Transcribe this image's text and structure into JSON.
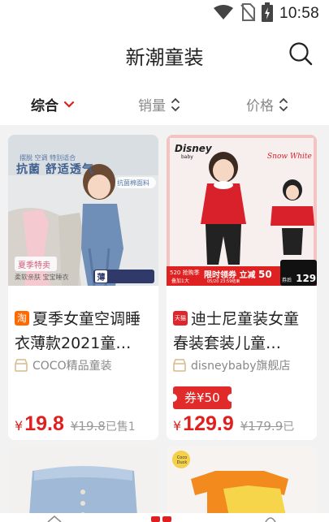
{
  "status_bar": {
    "time": "10:58",
    "icons": [
      "wifi-icon",
      "no-sim-icon",
      "battery-charging-icon"
    ]
  },
  "header": {
    "title": "新潮童装",
    "search_icon": "search-icon"
  },
  "sort_bar": {
    "items": [
      {
        "label": "综合",
        "state": "active"
      },
      {
        "label": "销量",
        "state": "sortable"
      },
      {
        "label": "价格",
        "state": "sortable"
      }
    ],
    "accent_color": "#e02020"
  },
  "products": [
    {
      "image_text": {
        "top_line": "摆脱 空调 特别适合",
        "headline": "抗菌 舒适透气",
        "badge": "抗菌棉面料",
        "bottom_left": "夏季特卖",
        "bottom_caption": "柔软亲肤 宝宝睡衣",
        "logo": "薄"
      },
      "platform_badge": "淘",
      "title": "夏季女童空调睡衣薄款2021童…",
      "shop": "COCO精品童装",
      "coupon": "",
      "currency": "¥",
      "price": "19.8",
      "original_price": "¥19.8",
      "sold": "已售1"
    },
    {
      "image_text": {
        "brand": "Disney",
        "brand_sub": "baby",
        "series": "Snow White",
        "promo_left": "520 抢购季",
        "promo_left_sub": "叠加1大",
        "promo_main": "限时领券 立减",
        "promo_amount": "50",
        "promo_date": "05/20 23:59结束",
        "promo_price_label": "券后",
        "promo_price": "129",
        "promo_price_unit": "起"
      },
      "platform_badge": "天猫",
      "title": "迪士尼童装女童春装套装儿童…",
      "shop": "disneybaby旗舰店",
      "coupon": "券¥50",
      "currency": "¥",
      "price": "129.9",
      "original_price": "¥179.9",
      "sold": "已"
    },
    {
      "image_text": {},
      "platform_badge": "",
      "title": "",
      "shop": "",
      "coupon": "",
      "currency": "",
      "price": "",
      "original_price": "",
      "sold": ""
    },
    {
      "image_text": {
        "corner_logo": "Coco Duck"
      },
      "platform_badge": "",
      "title": "",
      "shop": "",
      "coupon": "",
      "currency": "",
      "price": "",
      "original_price": "",
      "sold": ""
    }
  ],
  "bottom_nav": {
    "icons": [
      "home-icon",
      "category-icon",
      "profile-icon"
    ]
  }
}
